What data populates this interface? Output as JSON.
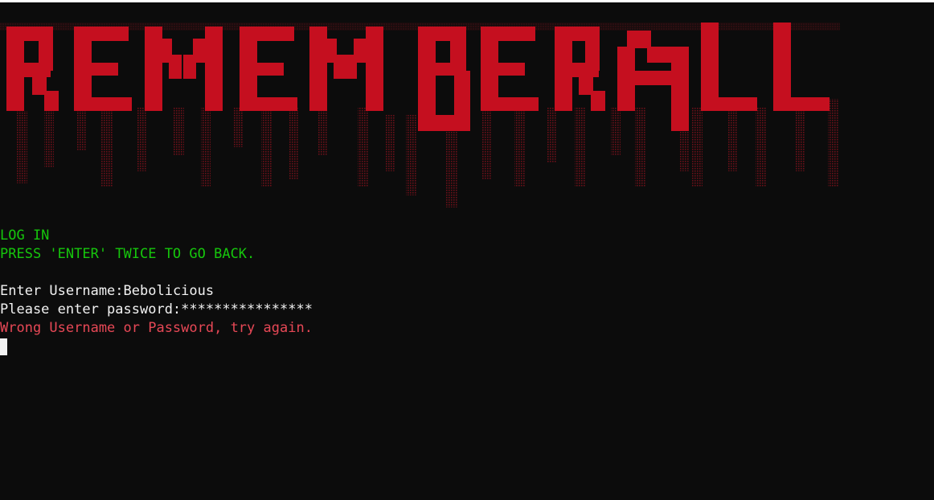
{
  "banner": {
    "art_word": "REMEMBERALL",
    "color": "#c50f1f"
  },
  "console": {
    "heading": "LOG IN",
    "hint": "PRESS 'ENTER' TWICE TO GO BACK.",
    "username_prompt": "Enter Username:",
    "username_value": "Bebolicious",
    "password_prompt": "Please enter password:",
    "password_value": "****************",
    "error": "Wrong Username or Password, try again."
  },
  "colors": {
    "background": "#0c0c0c",
    "heading": "#16c60c",
    "text": "#f2f2f2",
    "error": "#e74856",
    "banner": "#c50f1f"
  }
}
